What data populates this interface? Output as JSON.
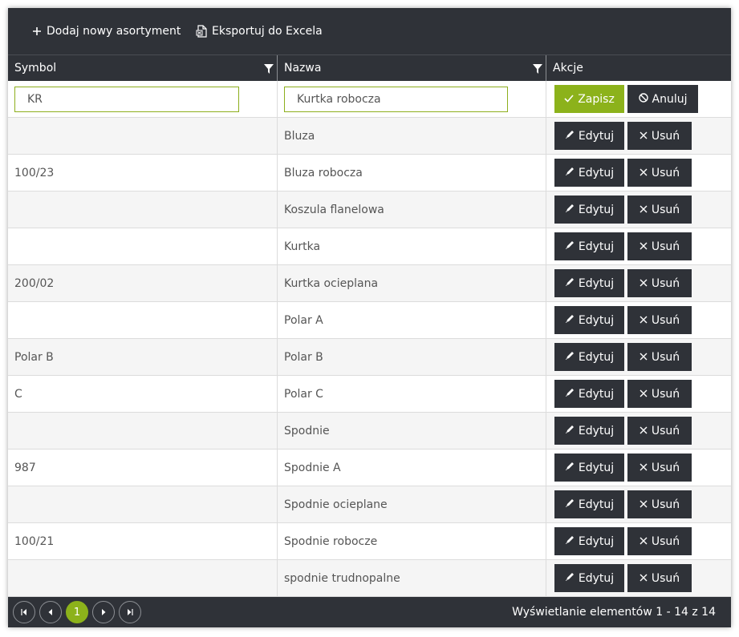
{
  "toolbar": {
    "add_label": "Dodaj nowy asortyment",
    "export_label": "Eksportuj do Excela"
  },
  "columns": {
    "symbol": "Symbol",
    "name": "Nazwa",
    "actions": "Akcje"
  },
  "edit_row": {
    "symbol_value": "KR",
    "name_value": "Kurtka robocza",
    "save_label": "Zapisz",
    "cancel_label": "Anuluj"
  },
  "row_actions": {
    "edit_label": "Edytuj",
    "delete_label": "Usuń"
  },
  "rows": [
    {
      "symbol": "",
      "name": "Bluza"
    },
    {
      "symbol": "100/23",
      "name": "Bluza robocza"
    },
    {
      "symbol": "",
      "name": "Koszula flanelowa"
    },
    {
      "symbol": "",
      "name": "Kurtka"
    },
    {
      "symbol": "200/02",
      "name": "Kurtka ocieplana"
    },
    {
      "symbol": "",
      "name": "Polar A"
    },
    {
      "symbol": "Polar B",
      "name": "Polar B"
    },
    {
      "symbol": "C",
      "name": "Polar C"
    },
    {
      "symbol": "",
      "name": "Spodnie"
    },
    {
      "symbol": "987",
      "name": "Spodnie A"
    },
    {
      "symbol": "",
      "name": "Spodnie ocieplane"
    },
    {
      "symbol": "100/21",
      "name": "Spodnie robocze"
    },
    {
      "symbol": "",
      "name": "spodnie trudnopalne"
    }
  ],
  "pager": {
    "current_page": "1",
    "status_text": "Wyświetlanie elementów 1 - 14 z 14"
  },
  "colors": {
    "dark": "#2f3238",
    "accent": "#8cb21b",
    "row_alt": "#f5f5f5"
  }
}
